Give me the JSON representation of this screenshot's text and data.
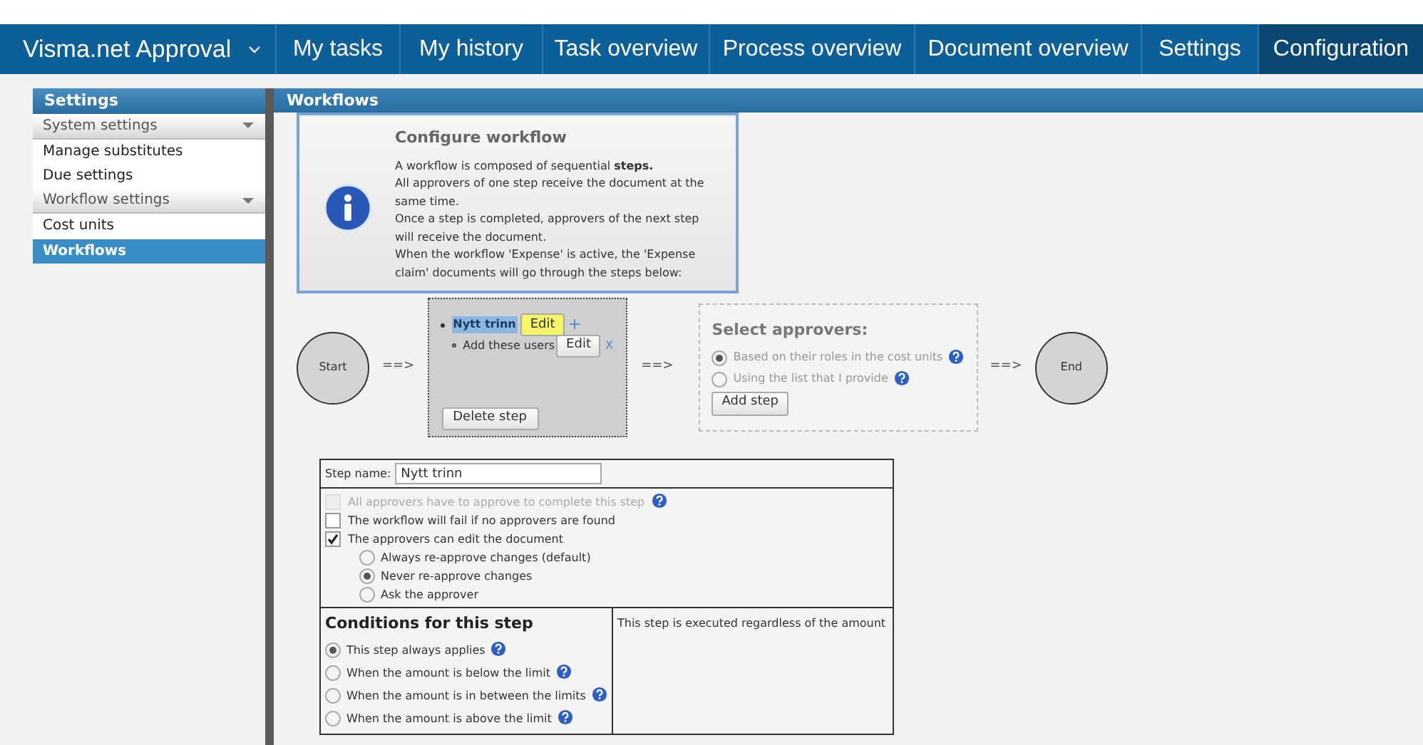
{
  "nav": {
    "brand": "Visma.net Approval",
    "items": [
      {
        "label": "My tasks",
        "selected": false
      },
      {
        "label": "My history",
        "selected": false
      },
      {
        "label": "Task overview",
        "selected": false
      },
      {
        "label": "Process overview",
        "selected": false
      },
      {
        "label": "Document overview",
        "selected": false
      },
      {
        "label": "Settings",
        "selected": false
      },
      {
        "label": "Configuration",
        "selected": true
      }
    ]
  },
  "sidebar": {
    "title": "Settings",
    "items": [
      {
        "kind": "group",
        "label": "System settings",
        "selected": false
      },
      {
        "kind": "link",
        "label": "Manage substitutes",
        "selected": false
      },
      {
        "kind": "link",
        "label": "Due settings",
        "selected": false
      },
      {
        "kind": "group",
        "label": "Workflow settings",
        "selected": false
      },
      {
        "kind": "link",
        "label": "Cost units",
        "selected": false
      },
      {
        "kind": "link",
        "label": "Workflows",
        "selected": true
      }
    ]
  },
  "content": {
    "title": "Workflows",
    "info": {
      "title": "Configure workflow",
      "lines": [
        "A workflow is composed of sequential **steps.**",
        "All approvers of one step receive the document at the same time.",
        "Once a step is completed, approvers of the next step will receive the document.",
        "When the workflow 'Expense' is active, the 'Expense claim' documents will go through the steps below:"
      ]
    },
    "flow": {
      "start": "Start",
      "arrows": [
        "==>",
        "==>",
        "==>"
      ],
      "step": {
        "name": "Nytt trinn",
        "edit": "Edit",
        "add": "+",
        "user_item": "Add these users",
        "user_edit": "Edit",
        "remove": "X",
        "delete": "Delete step"
      },
      "approvers": {
        "title": "Select approvers:",
        "options": [
          {
            "label": "Based on their roles in the cost units",
            "selected": true,
            "help": true
          },
          {
            "label": "Using the list that I provide",
            "selected": false,
            "help": true
          }
        ],
        "add": "Add step"
      },
      "end": "End"
    },
    "form": {
      "step_name_label": "Step name:",
      "step_name_value": "Nytt trinn",
      "checks": [
        {
          "label": "All approvers have to approve to complete this step",
          "checked": false,
          "disabled": true,
          "help": true
        },
        {
          "label": "The workflow will fail if no approvers are found",
          "checked": false,
          "disabled": false,
          "help": false
        },
        {
          "label": "The approvers can edit the document",
          "checked": true,
          "disabled": false,
          "help": false
        }
      ],
      "edit_options": [
        {
          "label": "Always re-approve changes (default)",
          "selected": false
        },
        {
          "label": "Never re-approve changes",
          "selected": true
        },
        {
          "label": "Ask the approver",
          "selected": false
        }
      ],
      "conditions_title": "Conditions for this step",
      "conditions": [
        {
          "label": "This step always applies",
          "selected": true,
          "help": true
        },
        {
          "label": "When the amount is below the limit",
          "selected": false,
          "help": true
        },
        {
          "label": "When the amount is in between the limits",
          "selected": false,
          "help": true
        },
        {
          "label": "When the amount is above the limit",
          "selected": false,
          "help": true
        }
      ],
      "note": "This step is executed regardless of the amount"
    }
  }
}
